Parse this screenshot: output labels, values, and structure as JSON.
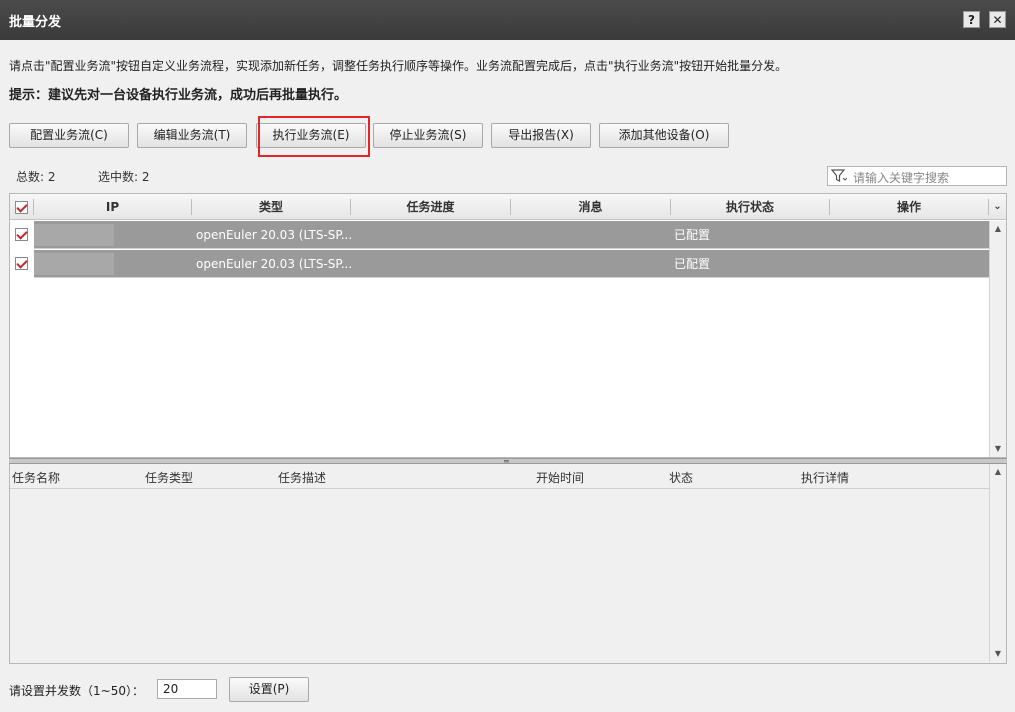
{
  "window": {
    "title": "批量分发",
    "help_label": "?",
    "close_label": "✕"
  },
  "intro_text": "请点击\"配置业务流\"按钮自定义业务流程，实现添加新任务，调整任务执行顺序等操作。业务流配置完成后，点击\"执行业务流\"按钮开始批量分发。",
  "tip_text": "提示：建议先对一台设备执行业务流，成功后再批量执行。",
  "toolbar": {
    "configure": "配置业务流(C)",
    "edit": "编辑业务流(T)",
    "execute": "执行业务流(E)",
    "stop": "停止业务流(S)",
    "export": "导出报告(X)",
    "add_device": "添加其他设备(O)"
  },
  "counts": {
    "total": "总数: 2",
    "selected": "选中数: 2"
  },
  "search": {
    "placeholder": "请输入关键字搜索"
  },
  "device_table": {
    "columns": [
      "IP",
      "类型",
      "任务进度",
      "消息",
      "执行状态",
      "操作"
    ],
    "rows": [
      {
        "ip": "",
        "type": "openEuler 20.03 (LTS-SP...",
        "progress": "",
        "message": "",
        "status": "已配置",
        "action": ""
      },
      {
        "ip": "",
        "type": "openEuler 20.03 (LTS-SP...",
        "progress": "",
        "message": "",
        "status": "已配置",
        "action": ""
      }
    ]
  },
  "task_table": {
    "columns": [
      "任务名称",
      "任务类型",
      "任务描述",
      "开始时间",
      "状态",
      "执行详情"
    ]
  },
  "concurrency": {
    "label": "请设置并发数（1~50）：",
    "value": "20",
    "set_button": "设置(P)"
  },
  "colors": {
    "highlight_border": "#e0262a",
    "selected_row": "#9a9a9a",
    "titlebar": "#424242"
  }
}
